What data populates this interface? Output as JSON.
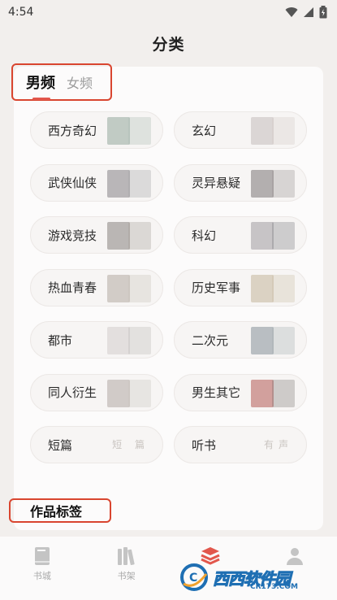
{
  "status_bar": {
    "time": "4:54"
  },
  "header": {
    "title": "分类"
  },
  "gender_tabs": [
    {
      "label": "男频",
      "active": true
    },
    {
      "label": "女频",
      "active": false
    }
  ],
  "categories": [
    {
      "label": "西方奇幻",
      "covers": [
        "#7f9a8a",
        "#a7b6ad"
      ]
    },
    {
      "label": "玄幻",
      "covers": [
        "#b9b2b0",
        "#cfc8c4"
      ]
    },
    {
      "label": "武侠仙侠",
      "covers": [
        "#6c6a6e",
        "#9b9aa0"
      ]
    },
    {
      "label": "灵异悬疑",
      "covers": [
        "#5f5a5c",
        "#8d8789"
      ]
    },
    {
      "label": "游戏竞技",
      "covers": [
        "#6f6a66",
        "#9a9490"
      ]
    },
    {
      "label": "科幻",
      "covers": [
        "#8c8a8e",
        "#6e6c74"
      ]
    },
    {
      "label": "热血青春",
      "covers": [
        "#a49c90",
        "#c2bcb2"
      ]
    },
    {
      "label": "历史军事",
      "covers": [
        "#b8a888",
        "#c7b9a0"
      ]
    },
    {
      "label": "都市",
      "covers": [
        "#c9c6c4",
        "#b6b2ae"
      ]
    },
    {
      "label": "二次元",
      "covers": [
        "#6d7d84",
        "#9ea9ad"
      ]
    },
    {
      "label": "同人衍生",
      "covers": [
        "#a19a92",
        "#c5bfb8"
      ]
    },
    {
      "label": "男生其它",
      "covers": [
        "#a43a34",
        "#6f6a66"
      ]
    },
    {
      "label": "短篇",
      "cover_text": "短 篇"
    },
    {
      "label": "听书",
      "cover_text": "有声"
    }
  ],
  "tags_section": {
    "title": "作品标签"
  },
  "bottom_nav": [
    {
      "label": "书城",
      "icon": "book-icon"
    },
    {
      "label": "书架",
      "icon": "bookshelf-icon"
    },
    {
      "label": "",
      "icon": "category-stack-icon",
      "active": true
    },
    {
      "label": "",
      "icon": "profile-icon"
    }
  ],
  "watermark": {
    "brand": "西西软件园",
    "site": "CR173.COM"
  },
  "colors": {
    "accent": "#e2574c",
    "highlight_border": "#d9452f"
  }
}
